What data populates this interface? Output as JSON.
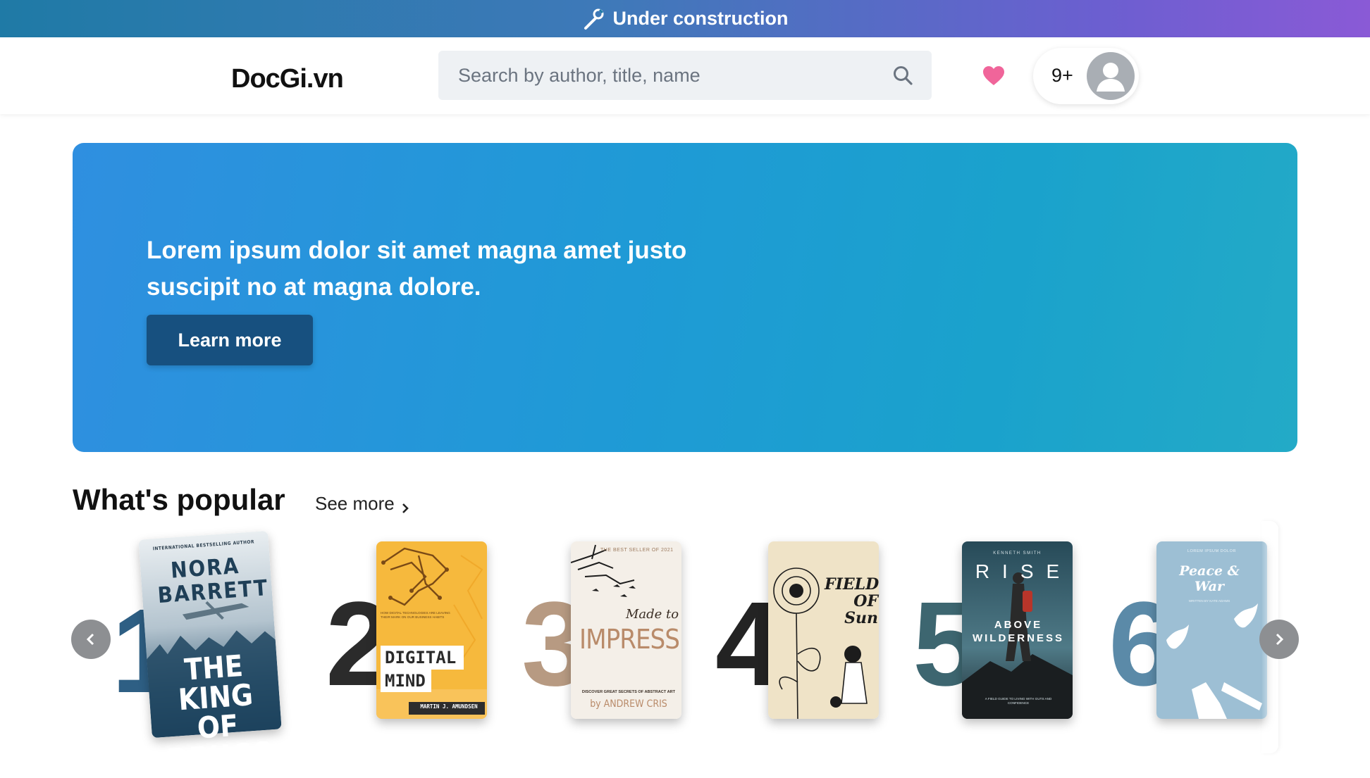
{
  "banner": {
    "text": "Under construction",
    "icon": "wrench-icon"
  },
  "header": {
    "logo": "DocGi.vn",
    "search_placeholder": "Search by author, title, name",
    "notifications_count": "9+"
  },
  "hero": {
    "text": "Lorem ipsum dolor sit amet magna amet justo suscipit no at magna dolore.",
    "button_label": "Learn more"
  },
  "popular": {
    "title": "What's popular",
    "see_more": "See more",
    "books": [
      {
        "rank": "1",
        "rank_color": "#2e5f84",
        "top_line": "INTERNATIONAL BESTSELLING AUTHOR",
        "author": "NORA BARRETT",
        "title": "THE KING OF DRUGS"
      },
      {
        "rank": "2",
        "rank_color": "#2b2b2b",
        "top_line": "HOW DIGITAL TECHNOLOGIES ARE LEAVING THEIR MARK ON OUR BUSINESS HABITS",
        "title": "DIGITAL MIND",
        "author": "MARTIN J. AMUNDSEN"
      },
      {
        "rank": "3",
        "rank_color": "#b79a82",
        "top_line": "THE BEST SELLER OF 2021",
        "subtitle": "Made to",
        "title": "IMPRESS",
        "tagline": "DISCOVER GREAT SECRETS OF ABSTRACT ART",
        "author": "by ANDREW CRIS"
      },
      {
        "rank": "4",
        "rank_color": "#232323",
        "title": "FIELD OF Sun"
      },
      {
        "rank": "5",
        "rank_color": "#3d6670",
        "author": "KENNETH SMITH",
        "title": "RISE",
        "subtitle": "ABOVE WILDERNESS",
        "tagline": "A FIELD GUIDE TO LIVING WITH GUTS AND CONFIDENCE"
      },
      {
        "rank": "6",
        "rank_color": "#5b8aa8",
        "top_line": "LOREM IPSUM DOLOR",
        "title": "Peace & War",
        "author": "WRITTEN BY KATE ADAMS"
      }
    ]
  }
}
